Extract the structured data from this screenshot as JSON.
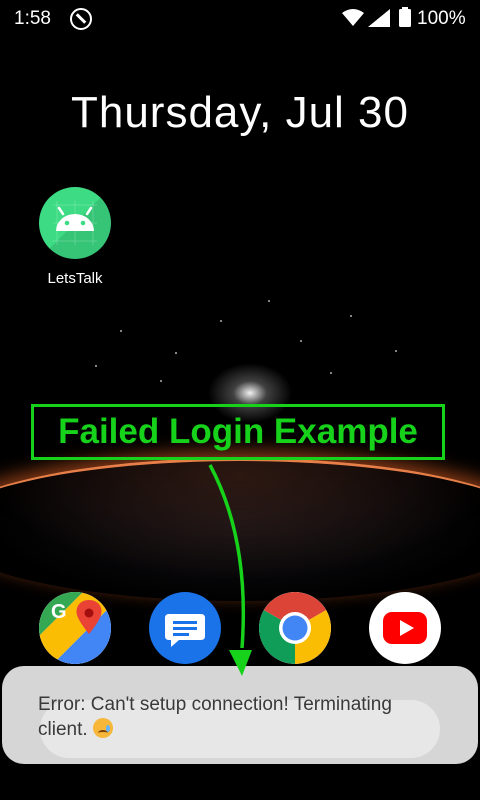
{
  "status_bar": {
    "time": "1:58",
    "battery": "100%",
    "icons": [
      "app-notification-icon",
      "wifi-icon",
      "signal-icon",
      "battery-icon"
    ]
  },
  "home": {
    "date": "Thursday, Jul 30",
    "apps": [
      {
        "label": "LetsTalk",
        "icon": "android-icon"
      }
    ],
    "dock": [
      "maps-icon",
      "messages-icon",
      "chrome-icon",
      "youtube-icon"
    ]
  },
  "annotation": {
    "label": "Failed Login Example",
    "color": "#16d21a"
  },
  "toast": {
    "message": "Error: Can't setup connection! Terminating client.",
    "emoji": "crying-face-icon"
  },
  "colors": {
    "android_green": "#3ddc84",
    "messages_blue": "#1a73e8",
    "youtube_red": "#ff0000"
  }
}
